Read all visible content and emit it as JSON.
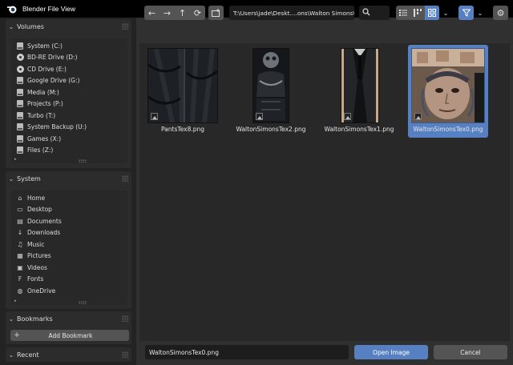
{
  "window": {
    "title": "Blender File View",
    "minimize": "—",
    "maximize": "☐",
    "close": "✕"
  },
  "sidebar": {
    "volumes": {
      "title": "Volumes",
      "items": [
        {
          "label": "System (C:)",
          "icon": "drive-icon"
        },
        {
          "label": "BD-RE Drive (D:)",
          "icon": "disc-icon"
        },
        {
          "label": "CD Drive (E:)",
          "icon": "disc-icon"
        },
        {
          "label": "Google Drive (G:)",
          "icon": "drive-icon"
        },
        {
          "label": "Media (M:)",
          "icon": "drive-icon"
        },
        {
          "label": "Projects (P:)",
          "icon": "drive-icon"
        },
        {
          "label": "Turbo (T:)",
          "icon": "drive-icon"
        },
        {
          "label": "System Backup (U:)",
          "icon": "drive-icon"
        },
        {
          "label": "Games (X:)",
          "icon": "drive-icon"
        },
        {
          "label": "Files (Z:)",
          "icon": "drive-icon"
        }
      ]
    },
    "system": {
      "title": "System",
      "items": [
        {
          "label": "Home",
          "icon": "home-icon"
        },
        {
          "label": "Desktop",
          "icon": "desktop-icon"
        },
        {
          "label": "Documents",
          "icon": "documents-icon"
        },
        {
          "label": "Downloads",
          "icon": "download-icon"
        },
        {
          "label": "Music",
          "icon": "music-icon"
        },
        {
          "label": "Pictures",
          "icon": "pictures-icon"
        },
        {
          "label": "Videos",
          "icon": "videos-icon"
        },
        {
          "label": "Fonts",
          "icon": "fonts-icon"
        },
        {
          "label": "OneDrive",
          "icon": "globe-icon"
        }
      ]
    },
    "bookmarks": {
      "title": "Bookmarks",
      "add_label": "Add Bookmark"
    },
    "recent": {
      "title": "Recent"
    }
  },
  "toolbar": {
    "path": "T:\\Users\\jade\\Deskt....ons\\Walton Simons\\",
    "search_placeholder": ""
  },
  "files": [
    {
      "name": "PantsTex8.png",
      "selected": false
    },
    {
      "name": "WaltonSimonsTex2.png",
      "selected": false
    },
    {
      "name": "WaltonSimonsTex1.png",
      "selected": false
    },
    {
      "name": "WaltonSimonsTex0.png",
      "selected": true
    }
  ],
  "footer": {
    "filename": "WaltonSimonsTex0.png",
    "open_label": "Open Image",
    "cancel_label": "Cancel"
  },
  "colors": {
    "accent": "#5680c2",
    "background": "#303030",
    "panel": "#232323"
  }
}
